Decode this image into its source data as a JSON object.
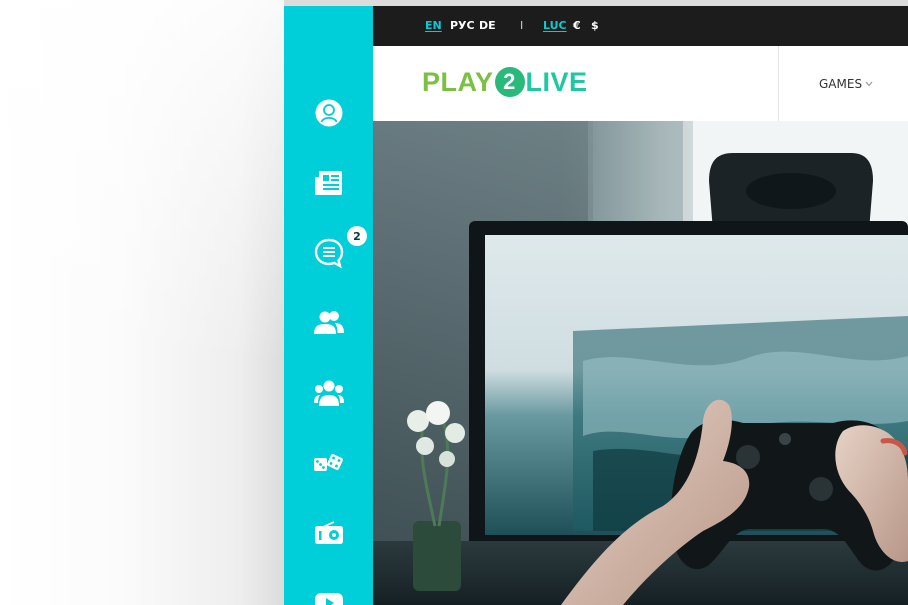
{
  "topbar": {
    "languages": [
      "EN",
      "РУС",
      "DE"
    ],
    "separator": "I",
    "currencies": [
      "LUC",
      "€",
      "$"
    ]
  },
  "header": {
    "logo": {
      "part1": "PLAY",
      "digit": "2",
      "part2": "LIVE"
    },
    "menu": {
      "games_label": "GAMES"
    }
  },
  "sidebar": {
    "items": [
      {
        "icon": "profile-icon"
      },
      {
        "icon": "news-icon"
      },
      {
        "icon": "chat-icon",
        "badge": "2"
      },
      {
        "icon": "friends-icon"
      },
      {
        "icon": "groups-icon"
      },
      {
        "icon": "games-dice-icon"
      },
      {
        "icon": "radio-icon"
      },
      {
        "icon": "video-icon"
      }
    ]
  },
  "colors": {
    "sidebar": "#00ced8",
    "topbar": "#1c1c1c",
    "accent": "#00ced8",
    "logo_green": "#7bc043",
    "logo_teal": "#1ec8a0"
  }
}
